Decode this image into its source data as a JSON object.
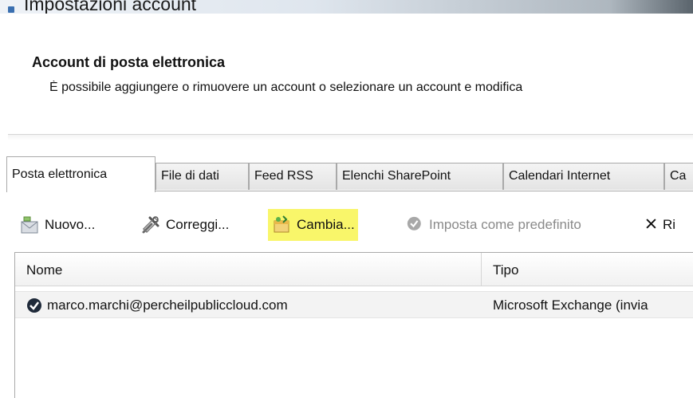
{
  "window": {
    "title": "Impostazioni account"
  },
  "header": {
    "heading": "Account di posta elettronica",
    "description": "È possibile aggiungere o rimuovere un account o selezionare un account e modifica"
  },
  "tabs": [
    {
      "label": "Posta elettronica",
      "active": true
    },
    {
      "label": "File di dati"
    },
    {
      "label": "Feed RSS"
    },
    {
      "label": "Elenchi SharePoint"
    },
    {
      "label": "Calendari Internet"
    },
    {
      "label": "Ca"
    }
  ],
  "toolbar": {
    "new_label": "Nuovo...",
    "repair_label": "Correggi...",
    "change_label": "Cambia...",
    "set_default_label": "Imposta come predefinito",
    "remove_label": "Ri"
  },
  "accounts_table": {
    "columns": [
      "Nome",
      "Tipo"
    ],
    "rows": [
      {
        "name": "marco.marchi@percheilpubliccloud.com",
        "type": "Microsoft Exchange (invia"
      }
    ]
  },
  "colors": {
    "highlight": "#f9f66a",
    "tab_border": "#a9a9a9",
    "row_background": "#f3f3f3"
  }
}
